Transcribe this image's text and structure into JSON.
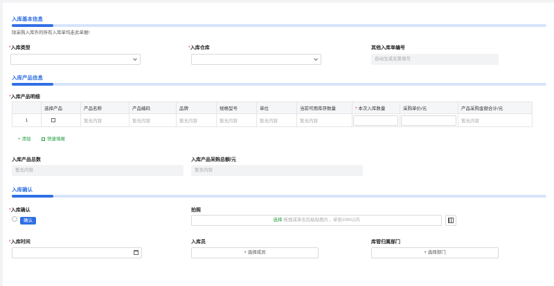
{
  "sections": {
    "basic": "入库基本信息",
    "product": "入库产品信息",
    "confirm": "入库确认"
  },
  "notice": "除采购入库外的所有入库单均走此单据!",
  "fields": {
    "stock_type": {
      "label": "入库类型",
      "value": ""
    },
    "warehouse": {
      "label": "入库仓库",
      "value": ""
    },
    "other_no": {
      "label": "其他入库单编号",
      "placeholder": "自动生成无需填写"
    },
    "detail": {
      "label": "入库产品明细"
    },
    "total_qty": {
      "label": "入库产品总数",
      "value": "暂无内容"
    },
    "total_amount": {
      "label": "入库产品采购总额/元",
      "value": "暂无内容"
    },
    "confirm": {
      "label": "入库确认",
      "tag": "确认"
    },
    "photo": {
      "label": "拍照",
      "select": "选择",
      "hint": "拖拽或单击后粘贴图片，单张20M以内"
    },
    "time": {
      "label": "入库时间",
      "value": ""
    },
    "staff": {
      "label": "入库员",
      "button": "+ 选择成员"
    },
    "dept": {
      "label": "库管归属部门",
      "button": "+ 选择部门"
    }
  },
  "table": {
    "headers": [
      "",
      "选择产品",
      "产品名称",
      "产品编码",
      "品牌",
      "规格型号",
      "单位",
      "当前可用库存数量",
      "本次入库数量",
      "采购单价/元",
      "产品采购金额合计/元"
    ],
    "rows": [
      {
        "index": "1",
        "empty": "暂无内容"
      }
    ]
  },
  "actions": {
    "add": "+ 添加",
    "quick": "快速填报"
  }
}
